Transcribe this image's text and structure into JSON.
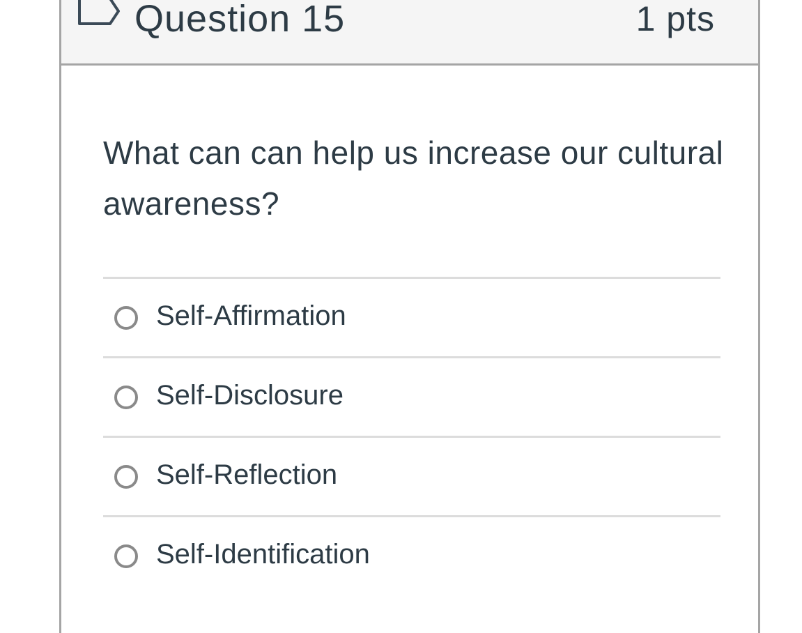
{
  "question": {
    "title": "Question 15",
    "points": "1 pts",
    "text": "What can can help us increase our cultural awareness?"
  },
  "answers": [
    {
      "label": "Self-Affirmation",
      "selected": false
    },
    {
      "label": "Self-Disclosure",
      "selected": false
    },
    {
      "label": "Self-Reflection",
      "selected": false
    },
    {
      "label": "Self-Identification",
      "selected": false
    }
  ],
  "icons": {
    "flag": "bookmark-flag-icon",
    "radio": "radio-button-unchecked"
  },
  "colors": {
    "text": "#2d3b45",
    "header_bg": "#f5f5f5",
    "border": "#a5a5a5",
    "divider": "#dcdcdc",
    "radio_border": "#8a8a8a"
  }
}
